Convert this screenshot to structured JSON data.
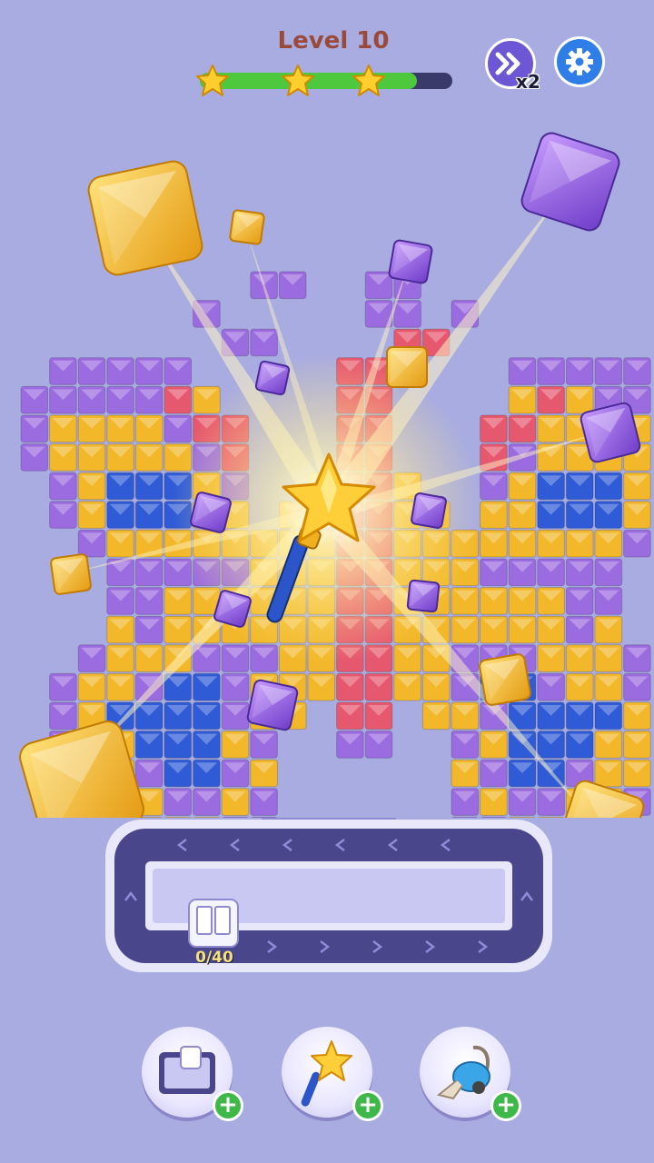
{
  "hud": {
    "level_label": "Level 10",
    "progress": 0.86,
    "stars": [
      {
        "icon": "star-icon",
        "at_progress": 0.05
      },
      {
        "icon": "star-icon",
        "at_progress": 0.39
      },
      {
        "icon": "star-icon",
        "at_progress": 0.67
      }
    ],
    "speed_button": {
      "icon": "fast-forward-icon",
      "multiplier_label": "x2"
    },
    "settings_button": {
      "icon": "gear-icon"
    }
  },
  "board": {
    "colors": {
      "purple": "#9b6be0",
      "yellow": "#f2b82a",
      "red": "#e6586e",
      "blue": "#2f5bd6"
    },
    "active_booster_icon": "magic-wand-icon"
  },
  "tray": {
    "counter_label": "0/40",
    "conveyor_icon": "chevron-icon",
    "track_color": "#4a468c"
  },
  "boosters": [
    {
      "name": "tray-booster",
      "icon": "tray-icon"
    },
    {
      "name": "wand-booster",
      "icon": "magic-wand-icon"
    },
    {
      "name": "vacuum-booster",
      "icon": "vacuum-icon"
    }
  ],
  "accent_colors": {
    "progress_fill": "#4ec93e",
    "speed_button": "#6d57d4",
    "settings_button": "#2f7ee8",
    "plus_badge": "#3fb84a"
  }
}
